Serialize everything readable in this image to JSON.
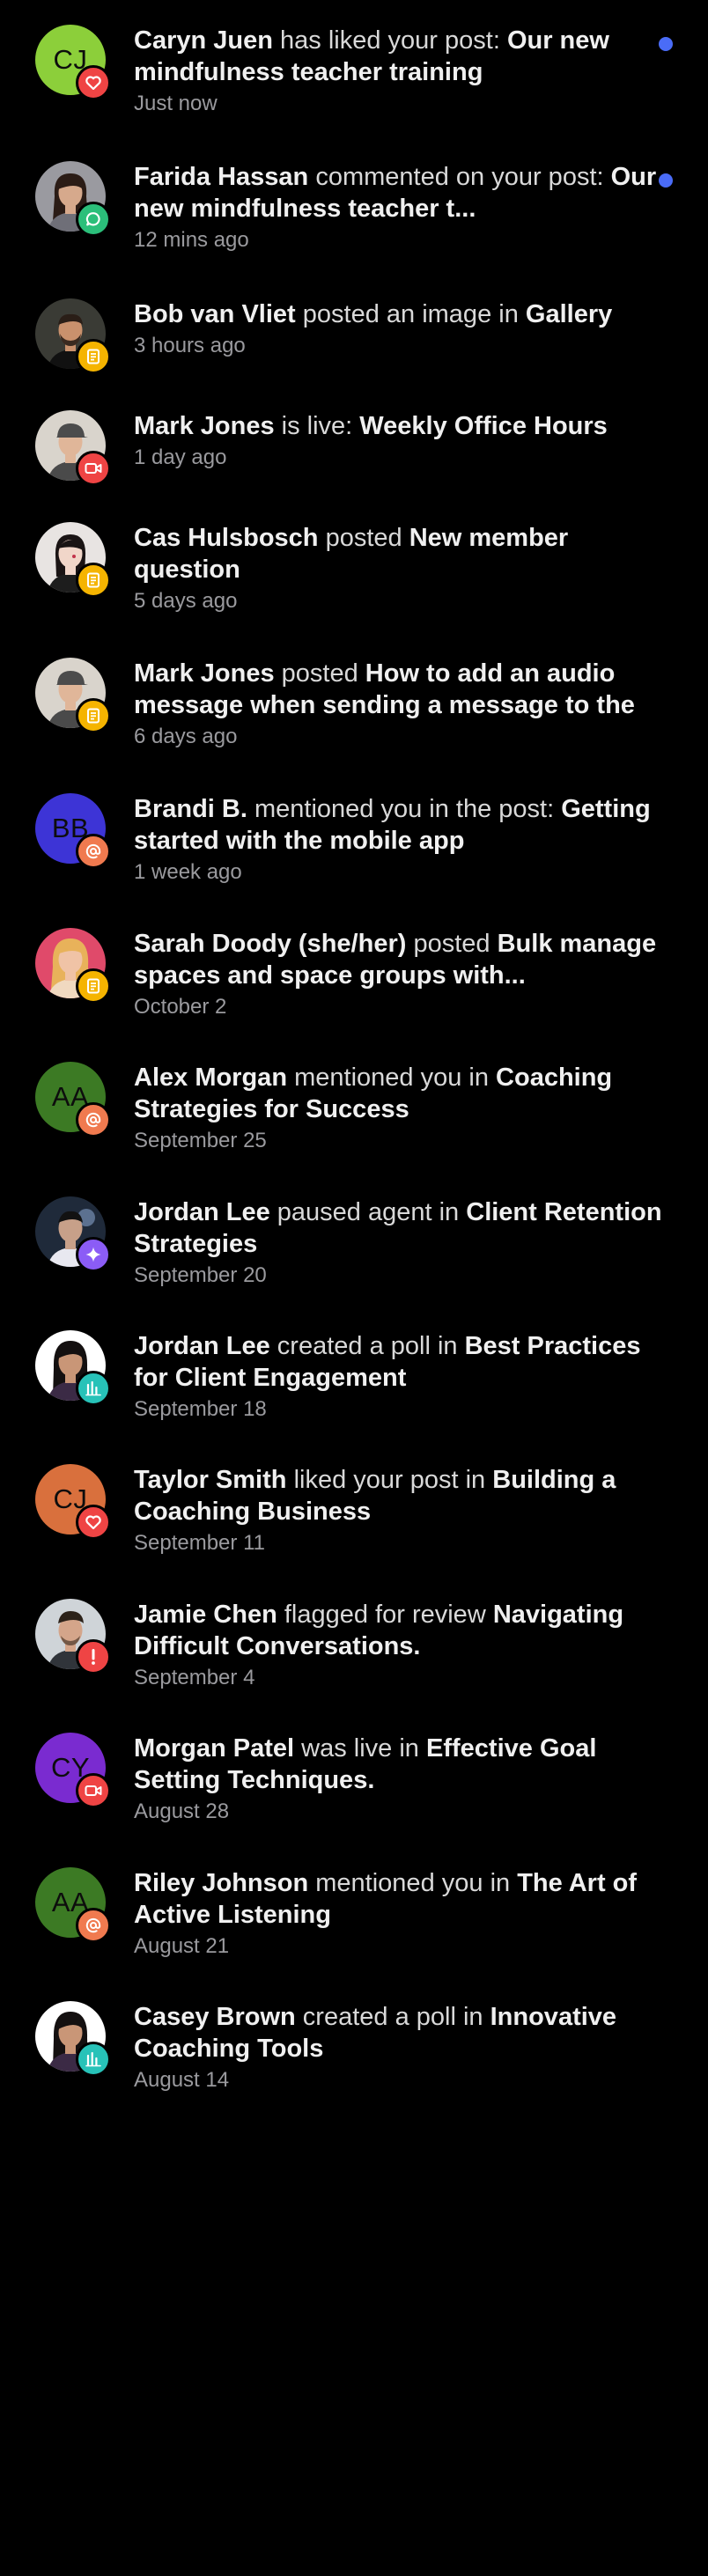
{
  "colors": {
    "background": "#000000",
    "unread": "#4a6cf7",
    "like": "#ef4444",
    "comment": "#2bbf7a",
    "post": "#f5b400",
    "live": "#ef4444",
    "mention": "#f07a4f",
    "agent": "#8b5cf6",
    "poll": "#27c2b8",
    "flag": "#ef4444"
  },
  "notifications": [
    {
      "actor": "Caryn Juen",
      "action": "has liked your post:",
      "target": "Our new mindfulness teacher training",
      "time": "Just now",
      "avatar": {
        "initials": "CJ",
        "color": "#8ccf3a"
      },
      "badge": "heart-icon",
      "unread": true
    },
    {
      "actor": "Farida Hassan",
      "action": "commented on your post:",
      "target": "Our new mindfulness teacher t...",
      "time": "12 mins ago",
      "avatar": {
        "photo": "woman-dark-hair"
      },
      "badge": "comment-icon",
      "unread": true
    },
    {
      "actor": "Bob van Vliet",
      "action": "posted an image in",
      "target": "Gallery",
      "time": "3 hours ago",
      "avatar": {
        "photo": "man-beard"
      },
      "badge": "post-icon",
      "unread": false
    },
    {
      "actor": "Mark Jones",
      "action": "is live:",
      "target": "Weekly Office Hours",
      "time": "1 day ago",
      "avatar": {
        "photo": "man-cap"
      },
      "badge": "video-icon",
      "unread": false
    },
    {
      "actor": "Cas Hulsbosch",
      "action": "posted",
      "target": "New member question",
      "time": "5 days ago",
      "avatar": {
        "photo": "woman-pale"
      },
      "badge": "post-icon",
      "unread": false
    },
    {
      "actor": "Mark Jones",
      "action": "posted",
      "target": "How to add an audio message when sending a message to the",
      "time": "6 days ago",
      "avatar": {
        "photo": "man-cap"
      },
      "badge": "post-icon",
      "unread": false
    },
    {
      "actor": "Brandi B.",
      "action": "mentioned you in the post:",
      "target": "Getting started with the mobile app",
      "time": "1 week ago",
      "avatar": {
        "initials": "BB",
        "color": "#3d34d6"
      },
      "badge": "at-icon",
      "unread": false
    },
    {
      "actor": "Sarah Doody (she/her)",
      "action": "posted",
      "target": "Bulk manage spaces and space groups with...",
      "time": "October 2",
      "avatar": {
        "photo": "woman-blonde"
      },
      "badge": "post-icon",
      "unread": false
    },
    {
      "actor": "Alex Morgan",
      "action": "mentioned you in",
      "target": "Coaching Strategies for Success",
      "time": "September 25",
      "avatar": {
        "initials": "AA",
        "color": "#3c7a24"
      },
      "badge": "at-icon",
      "unread": false
    },
    {
      "actor": "Jordan Lee",
      "action": "paused agent in",
      "target": "Client Retention Strategies",
      "time": "September 20",
      "avatar": {
        "photo": "person-dark"
      },
      "badge": "sparkle-icon",
      "unread": false
    },
    {
      "actor": "Jordan Lee",
      "action": "created a poll in",
      "target": "Best Practices for Client Engagement",
      "time": "September 18",
      "avatar": {
        "photo": "woman-long-hair"
      },
      "badge": "poll-icon",
      "unread": false
    },
    {
      "actor": "Taylor Smith",
      "action": "liked your post in",
      "target": "Building a Coaching Business",
      "time": "September 11",
      "avatar": {
        "initials": "CJ",
        "color": "#d9703d"
      },
      "badge": "heart-icon",
      "unread": false
    },
    {
      "actor": "Jamie Chen",
      "action": "flagged for review",
      "target": "Navigating Difficult Conversations.",
      "time": "September 4",
      "avatar": {
        "photo": "man-stubble"
      },
      "badge": "alert-icon",
      "unread": false
    },
    {
      "actor": "Morgan Patel",
      "action": "was live in",
      "target": "Effective Goal Setting Techniques.",
      "time": "August 28",
      "avatar": {
        "initials": "CY",
        "color": "#7a2bd0"
      },
      "badge": "video-icon",
      "unread": false
    },
    {
      "actor": "Riley Johnson",
      "action": "mentioned you in",
      "target": "The Art of Active Listening",
      "time": "August 21",
      "avatar": {
        "initials": "AA",
        "color": "#3c7a24"
      },
      "badge": "at-icon",
      "unread": false
    },
    {
      "actor": "Casey Brown",
      "action": "created a poll in",
      "target": "Innovative Coaching Tools",
      "time": "August 14",
      "avatar": {
        "photo": "woman-long-hair"
      },
      "badge": "poll-icon",
      "unread": false
    }
  ]
}
